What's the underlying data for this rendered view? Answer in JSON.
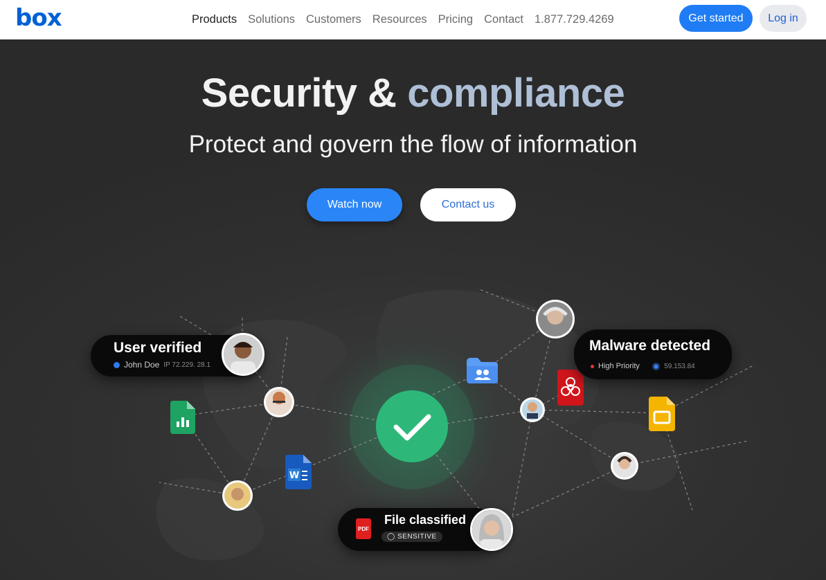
{
  "header": {
    "logo": "box",
    "nav": [
      "Products",
      "Solutions",
      "Customers",
      "Resources",
      "Pricing",
      "Contact",
      "1.877.729.4269"
    ],
    "get_started": "Get started",
    "login": "Log in"
  },
  "hero": {
    "title_main": "Security &",
    "title_accent": "compliance",
    "subtitle": "Protect and govern the flow of information",
    "watch_now": "Watch now",
    "contact_us": "Contact us"
  },
  "cards": {
    "user_verified": {
      "title": "User verified",
      "name": "John Doe",
      "ip": "IP  72.229. 28.1"
    },
    "malware": {
      "title": "Malware detected",
      "priority": "High Priority",
      "ip": "59.153.84"
    },
    "file": {
      "title": "File classified",
      "tag": "SENSITIVE",
      "pdf": "PDF"
    }
  },
  "colors": {
    "brand": "#0061d5",
    "accent": "#2a86f7",
    "success": "#27b67a"
  }
}
